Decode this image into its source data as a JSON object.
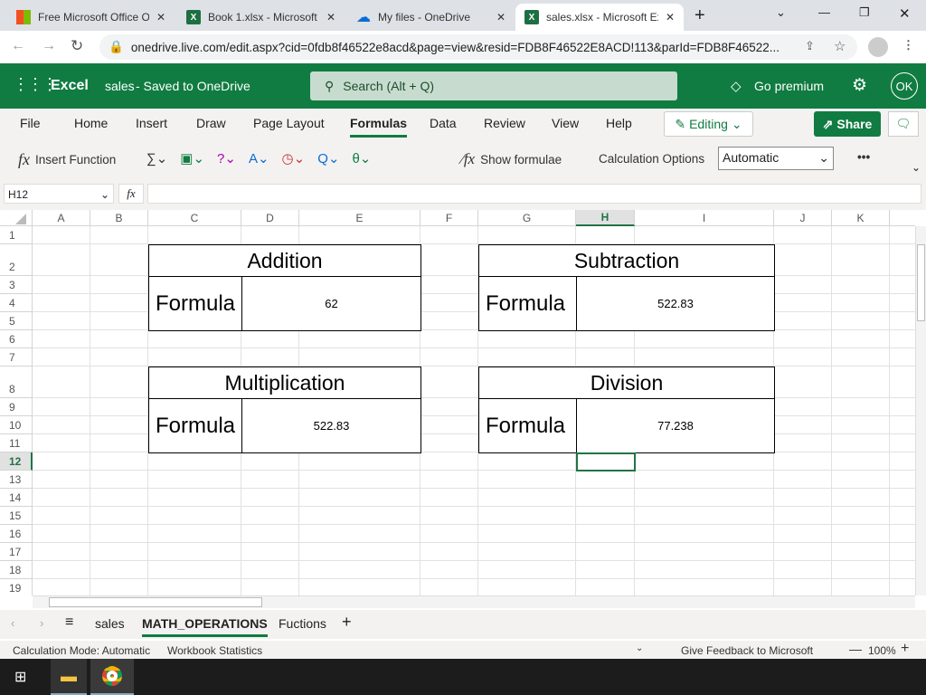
{
  "browser": {
    "tabs": [
      {
        "title": "Free Microsoft Office O"
      },
      {
        "title": "Book 1.xlsx - Microsoft"
      },
      {
        "title": "My files - OneDrive"
      },
      {
        "title": "sales.xlsx - Microsoft Ex"
      }
    ],
    "url": "onedrive.live.com/edit.aspx?cid=0fdb8f46522e8acd&page=view&resid=FDB8F46522E8ACD!113&parId=FDB8F46522..."
  },
  "app": {
    "name": "Excel",
    "file": "sales",
    "save_status": "-  Saved to OneDrive",
    "search_placeholder": "Search (Alt + Q)",
    "premium": "Go premium",
    "avatar": "OK"
  },
  "ribbon": {
    "tabs": [
      "File",
      "Home",
      "Insert",
      "Draw",
      "Page Layout",
      "Formulas",
      "Data",
      "Review",
      "View",
      "Help"
    ],
    "active": "Formulas",
    "editing": "Editing",
    "share": "Share",
    "insert_function": "Insert Function",
    "show_formulae": "Show formulae",
    "calc_options": "Calculation Options",
    "calc_value": "Automatic",
    "more": "•••"
  },
  "formula_bar": {
    "name_box": "H12",
    "fx": "fx",
    "value": ""
  },
  "grid": {
    "columns": [
      "A",
      "B",
      "C",
      "D",
      "E",
      "F",
      "G",
      "H",
      "I",
      "J",
      "K"
    ],
    "rows": [
      "1",
      "2",
      "3",
      "4",
      "5",
      "6",
      "7",
      "8",
      "9",
      "10",
      "11",
      "12",
      "13",
      "14",
      "15",
      "16",
      "17",
      "18",
      "19"
    ],
    "selected_cell": "H12"
  },
  "tables": [
    {
      "title": "Addition",
      "label": "Formula",
      "value": "62"
    },
    {
      "title": "Subtraction",
      "label": "Formula",
      "value": "522.83"
    },
    {
      "title": "Multiplication",
      "label": "Formula",
      "value": "522.83"
    },
    {
      "title": "Division",
      "label": "Formula",
      "value": "77.238"
    }
  ],
  "sheets": {
    "tabs": [
      "sales",
      "MATH_OPERATIONS",
      "Fuctions"
    ],
    "active": "MATH_OPERATIONS"
  },
  "status": {
    "calc_mode": "Calculation Mode: Automatic",
    "stats": "Workbook Statistics",
    "feedback": "Give Feedback to Microsoft",
    "zoom": "100%"
  },
  "colors": {
    "excel_green": "#107c41",
    "selection": "#217346"
  }
}
